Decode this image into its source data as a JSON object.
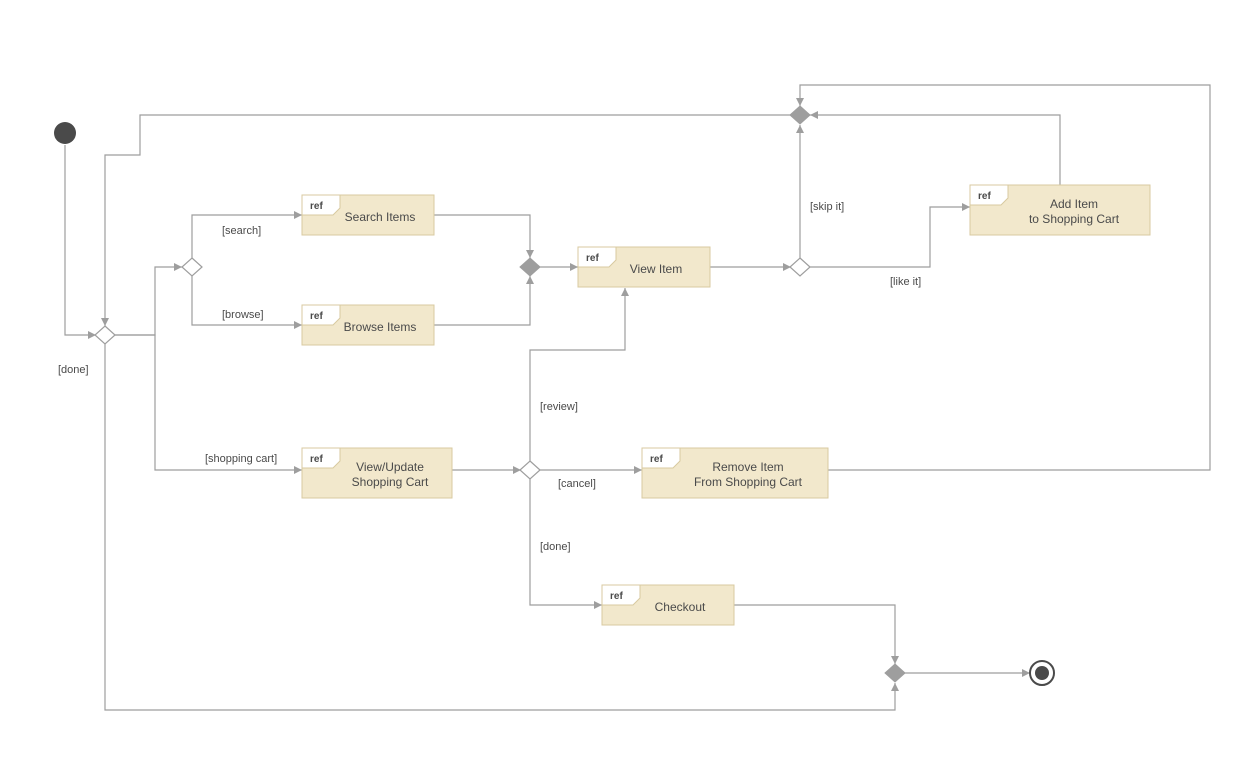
{
  "refs": {
    "search": {
      "label": "Search Items"
    },
    "browse": {
      "label": "Browse Items"
    },
    "view_item": {
      "label": "View Item"
    },
    "add_item": {
      "line1": "Add Item",
      "line2": "to Shopping Cart"
    },
    "view_cart": {
      "line1": "View/Update",
      "line2": "Shopping Cart"
    },
    "remove_item": {
      "line1": "Remove Item",
      "line2": "From Shopping Cart"
    },
    "checkout": {
      "label": "Checkout"
    }
  },
  "ref_tag": "ref",
  "guards": {
    "done": "[done]",
    "search": "[search]",
    "browse": "[browse]",
    "shopping_cart": "[shopping cart]",
    "review": "[review]",
    "cancel": "[cancel]",
    "done2": "[done]",
    "skip_it": "[skip it]",
    "like_it": "[like it]"
  }
}
